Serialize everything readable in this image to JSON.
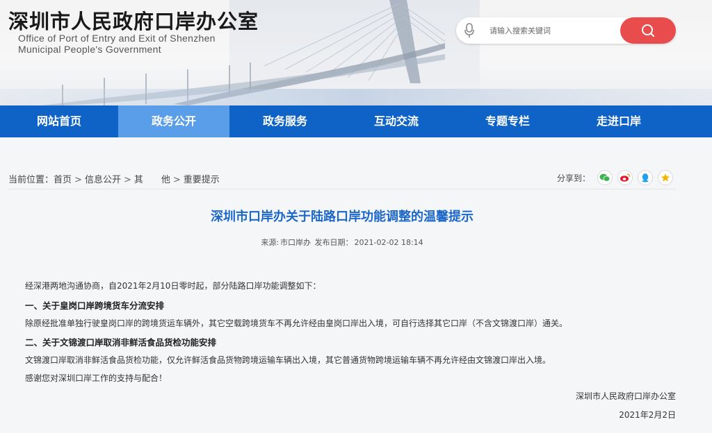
{
  "header": {
    "title": "深圳市人民政府口岸办公室",
    "subtitle_line1": "Office of Port of Entry and Exit of Shenzhen",
    "subtitle_line2": "Municipal People's Government",
    "search": {
      "placeholder": "请输入搜索关键词",
      "value": ""
    }
  },
  "nav": {
    "items": [
      {
        "label": "网站首页"
      },
      {
        "label": "政务公开"
      },
      {
        "label": "政务服务"
      },
      {
        "label": "互动交流"
      },
      {
        "label": "专题专栏"
      },
      {
        "label": "走进口岸"
      }
    ],
    "active_index": 1
  },
  "breadcrumb": {
    "prefix": "当前位置：",
    "items": [
      "首页",
      "信息公开",
      "其　　他",
      "重要提示"
    ],
    "separator": ">"
  },
  "share": {
    "label": "分享到：",
    "icons": [
      "wechat-icon",
      "weibo-icon",
      "qq-icon",
      "qzone-icon"
    ]
  },
  "article": {
    "title": "深圳市口岸办关于陆路口岸功能调整的温馨提示",
    "source_label": "来源:",
    "source": "市口岸办",
    "date_label": "发布日期：",
    "date": "2021-02-02 18:14",
    "paragraphs": [
      {
        "text": "经深港两地沟通协商，自2021年2月10日零时起，部分陆路口岸功能调整如下：",
        "bold": false
      },
      {
        "text": "一、关于皇岗口岸跨境货车分流安排",
        "bold": true
      },
      {
        "text": "除原经批准单独行驶皇岗口岸的跨境货运车辆外，其它空载跨境货车不再允许经由皇岗口岸出入境，可自行选择其它口岸（不含文锦渡口岸）通关。",
        "bold": false
      },
      {
        "text": "二、关于文锦渡口岸取消非鲜活食品货检功能安排",
        "bold": true
      },
      {
        "text": "文锦渡口岸取消非鲜活食品货检功能，仅允许鲜活食品货物跨境运输车辆出入境，其它普通货物跨境运输车辆不再允许经由文锦渡口岸出入境。",
        "bold": false
      },
      {
        "text": "感谢您对深圳口岸工作的支持与配合！",
        "bold": false
      }
    ],
    "signature": "深圳市人民政府口岸办公室",
    "sign_date": "2021年2月2日"
  },
  "colors": {
    "nav_bg": "#0f63c7",
    "nav_active": "#5a9ee9",
    "title_blue": "#1a66c9",
    "search_btn": "#e84c4c"
  }
}
